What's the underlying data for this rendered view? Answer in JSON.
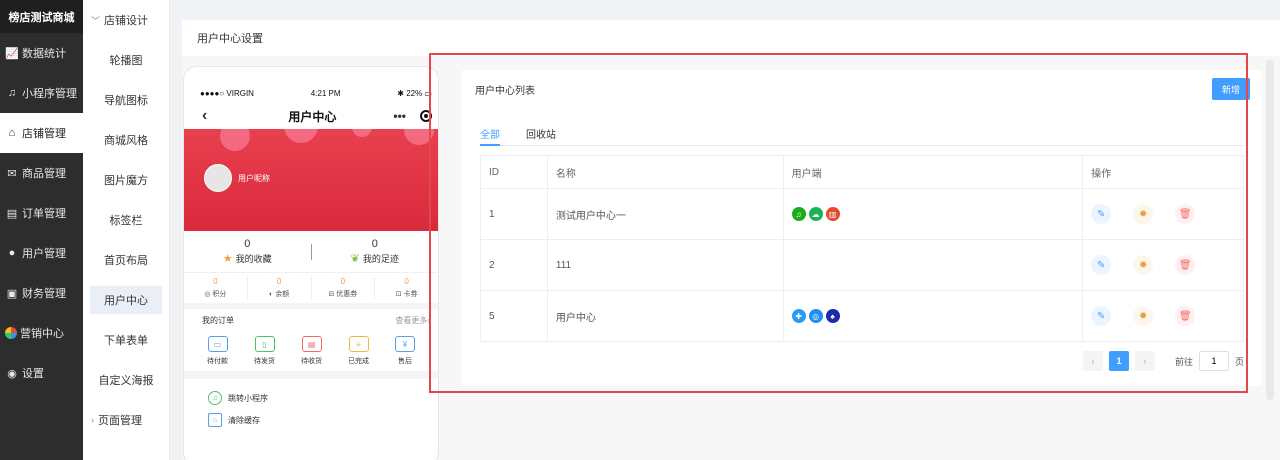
{
  "brand": "榜店测试商城",
  "nav": [
    {
      "label": "数据统计",
      "icon": "chart-icon"
    },
    {
      "label": "小程序管理",
      "icon": "miniprogram-icon"
    },
    {
      "label": "店铺管理",
      "icon": "store-icon",
      "active": true
    },
    {
      "label": "商品管理",
      "icon": "goods-icon"
    },
    {
      "label": "订单管理",
      "icon": "order-icon"
    },
    {
      "label": "用户管理",
      "icon": "user-icon"
    },
    {
      "label": "财务管理",
      "icon": "finance-icon"
    },
    {
      "label": "营销中心",
      "icon": "marketing-icon"
    },
    {
      "label": "设置",
      "icon": "settings-icon"
    }
  ],
  "submenu": {
    "group1": "店铺设计",
    "items": [
      "轮播图",
      "导航图标",
      "商城风格",
      "图片魔方",
      "标签栏",
      "首页布局",
      "用户中心",
      "下单表单",
      "自定义海报"
    ],
    "active_index": 6,
    "group2": "页面管理"
  },
  "page": {
    "title": "用户中心设置"
  },
  "phone": {
    "carrier": "●●●●○ VIRGIN",
    "time": "4:21 PM",
    "battery": "22%",
    "nav_title": "用户中心",
    "nickname": "用户昵称",
    "stats": [
      {
        "num": "0",
        "label": "我的收藏"
      },
      {
        "num": "0",
        "label": "我的足迹"
      }
    ],
    "assets": [
      {
        "val": "0",
        "label": "积分"
      },
      {
        "val": "0",
        "label": "余额"
      },
      {
        "val": "0",
        "label": "优惠券"
      },
      {
        "val": "0",
        "label": "卡券"
      }
    ],
    "orders_title": "我的订单",
    "orders_more": "查看更多",
    "orders": [
      "待付款",
      "待发货",
      "待收货",
      "已完成",
      "售后"
    ],
    "tools": [
      "跳转小程序",
      "清除缓存"
    ]
  },
  "list": {
    "title": "用户中心列表",
    "new_button": "新增",
    "tabs": [
      "全部",
      "回收站"
    ],
    "columns": [
      "ID",
      "名称",
      "用户端",
      "操作"
    ],
    "rows": [
      {
        "id": "1",
        "name": "测试用户中心一",
        "clients": [
          {
            "icon": "miniprogram-icon",
            "color": "#1aad19"
          },
          {
            "icon": "alipay-icon",
            "color": "#19b355"
          },
          {
            "icon": "toutiao-icon",
            "color": "#e64a2e"
          }
        ]
      },
      {
        "id": "2",
        "name": "111",
        "clients": []
      },
      {
        "id": "5",
        "name": "用户中心",
        "clients": [
          {
            "icon": "baidu-icon",
            "color": "#2b9af3"
          },
          {
            "icon": "alipay-icon",
            "color": "#1d8ff0"
          },
          {
            "icon": "qq-icon",
            "color": "#1c2ca8"
          }
        ]
      }
    ]
  },
  "pager": {
    "current": "1",
    "goto_label": "前往",
    "page_input": "1",
    "page_unit": "页"
  },
  "colors": {
    "primary": "#409eff",
    "hero": "#e03342",
    "sidebar": "#2d2d2d",
    "highlight": "#e3474e"
  }
}
